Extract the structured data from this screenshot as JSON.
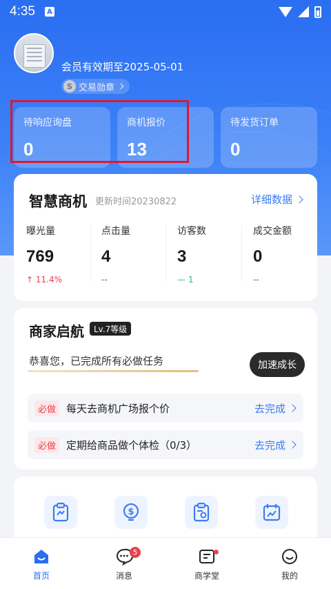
{
  "status_bar": {
    "time": "4:35",
    "notif_icon": "A"
  },
  "profile": {
    "member_expiry": "会员有效期至2025-05-01",
    "medal_label": "交易勋章",
    "medal_icon": "S"
  },
  "stats": [
    {
      "label": "待响应询盘",
      "value": "0"
    },
    {
      "label": "商机报价",
      "value": "13"
    },
    {
      "label": "待发货订单",
      "value": "0"
    }
  ],
  "smart": {
    "title": "智慧商机",
    "update_time": "更新时间20230822",
    "detail_link": "详细数据",
    "metrics": [
      {
        "label": "曝光量",
        "value": "769",
        "sub": "11.4%",
        "sub_prefix": "↑"
      },
      {
        "label": "点击量",
        "value": "4",
        "sub": "--"
      },
      {
        "label": "访客数",
        "value": "3",
        "sub": "1",
        "sub_prefix": "—"
      },
      {
        "label": "成交金额",
        "value": "0",
        "sub": "--"
      }
    ]
  },
  "merchant": {
    "title": "商家启航",
    "level": "Lv.7等级",
    "congrats": "恭喜您，已完成所有必做任务",
    "accelerate": "加速成长",
    "progress": 1.0,
    "tasks": [
      {
        "tag": "必做",
        "text": "每天去商机广场报个价",
        "action": "去完成"
      },
      {
        "tag": "必做",
        "text": "定期给商品做个体检（0/3）",
        "action": "去完成"
      }
    ]
  },
  "nav": [
    {
      "label": "首页",
      "icon": "home-icon"
    },
    {
      "label": "消息",
      "icon": "message-icon",
      "badge": "5"
    },
    {
      "label": "商学堂",
      "icon": "school-icon",
      "dot": true
    },
    {
      "label": "我的",
      "icon": "smile-icon"
    }
  ],
  "colors": {
    "primary": "#2a6ef2",
    "highlight": "#e3162b",
    "alert": "#e8434f"
  }
}
